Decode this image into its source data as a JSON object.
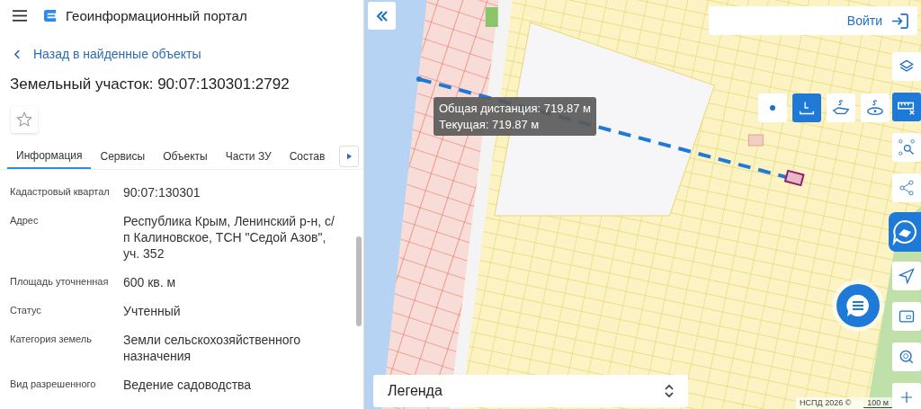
{
  "header": {
    "title": "Геоинформационный портал"
  },
  "back_link": "Назад в найденные объекты",
  "object_title": "Земельный участок: 90:07:130301:2792",
  "favorite": {
    "checked": false
  },
  "tabs": [
    {
      "label": "Информация",
      "selected": true
    },
    {
      "label": "Сервисы",
      "selected": false
    },
    {
      "label": "Объекты",
      "selected": false
    },
    {
      "label": "Части ЗУ",
      "selected": false
    },
    {
      "label": "Состав",
      "selected": false
    }
  ],
  "properties": [
    {
      "label": "Кадастровый квартал",
      "value": "90:07:130301"
    },
    {
      "label": "Адрес",
      "value": "Республика Крым, Ленинский р-н, с/п Калиновское, ТСН \"Седой Азов\", уч. 352"
    },
    {
      "label": "Площадь уточненная",
      "value": "600 кв. м"
    },
    {
      "label": "Статус",
      "value": "Учтенный"
    },
    {
      "label": "Категория земель",
      "value": "Земли сельскохозяйственного назначения"
    },
    {
      "label": "Вид разрешенного",
      "value": "Ведение садоводства"
    }
  ],
  "login_button": "Войти",
  "measure_tooltip": {
    "total": "Общая дистанция: 719.87 м",
    "current": "Текущая: 719.87 м"
  },
  "measure_tools": [
    {
      "kind": "point",
      "selected": false
    },
    {
      "kind": "length",
      "selected": true
    },
    {
      "kind": "area",
      "selected": false
    },
    {
      "kind": "circle",
      "selected": false
    }
  ],
  "side_buttons": [
    {
      "kind": "layers",
      "selected": false
    },
    {
      "kind": "ruler",
      "selected": true
    },
    {
      "kind": "select",
      "selected": false
    },
    {
      "kind": "share",
      "selected": false
    },
    {
      "kind": "assistant",
      "selected": true
    },
    {
      "kind": "navigate",
      "selected": false
    },
    {
      "kind": "screen",
      "selected": false
    },
    {
      "kind": "locate",
      "selected": false
    },
    {
      "kind": "zoom-in",
      "selected": false
    }
  ],
  "legend": {
    "label": "Легенда"
  },
  "attribution": "НСПД 2026 ©",
  "scale": "100 м"
}
